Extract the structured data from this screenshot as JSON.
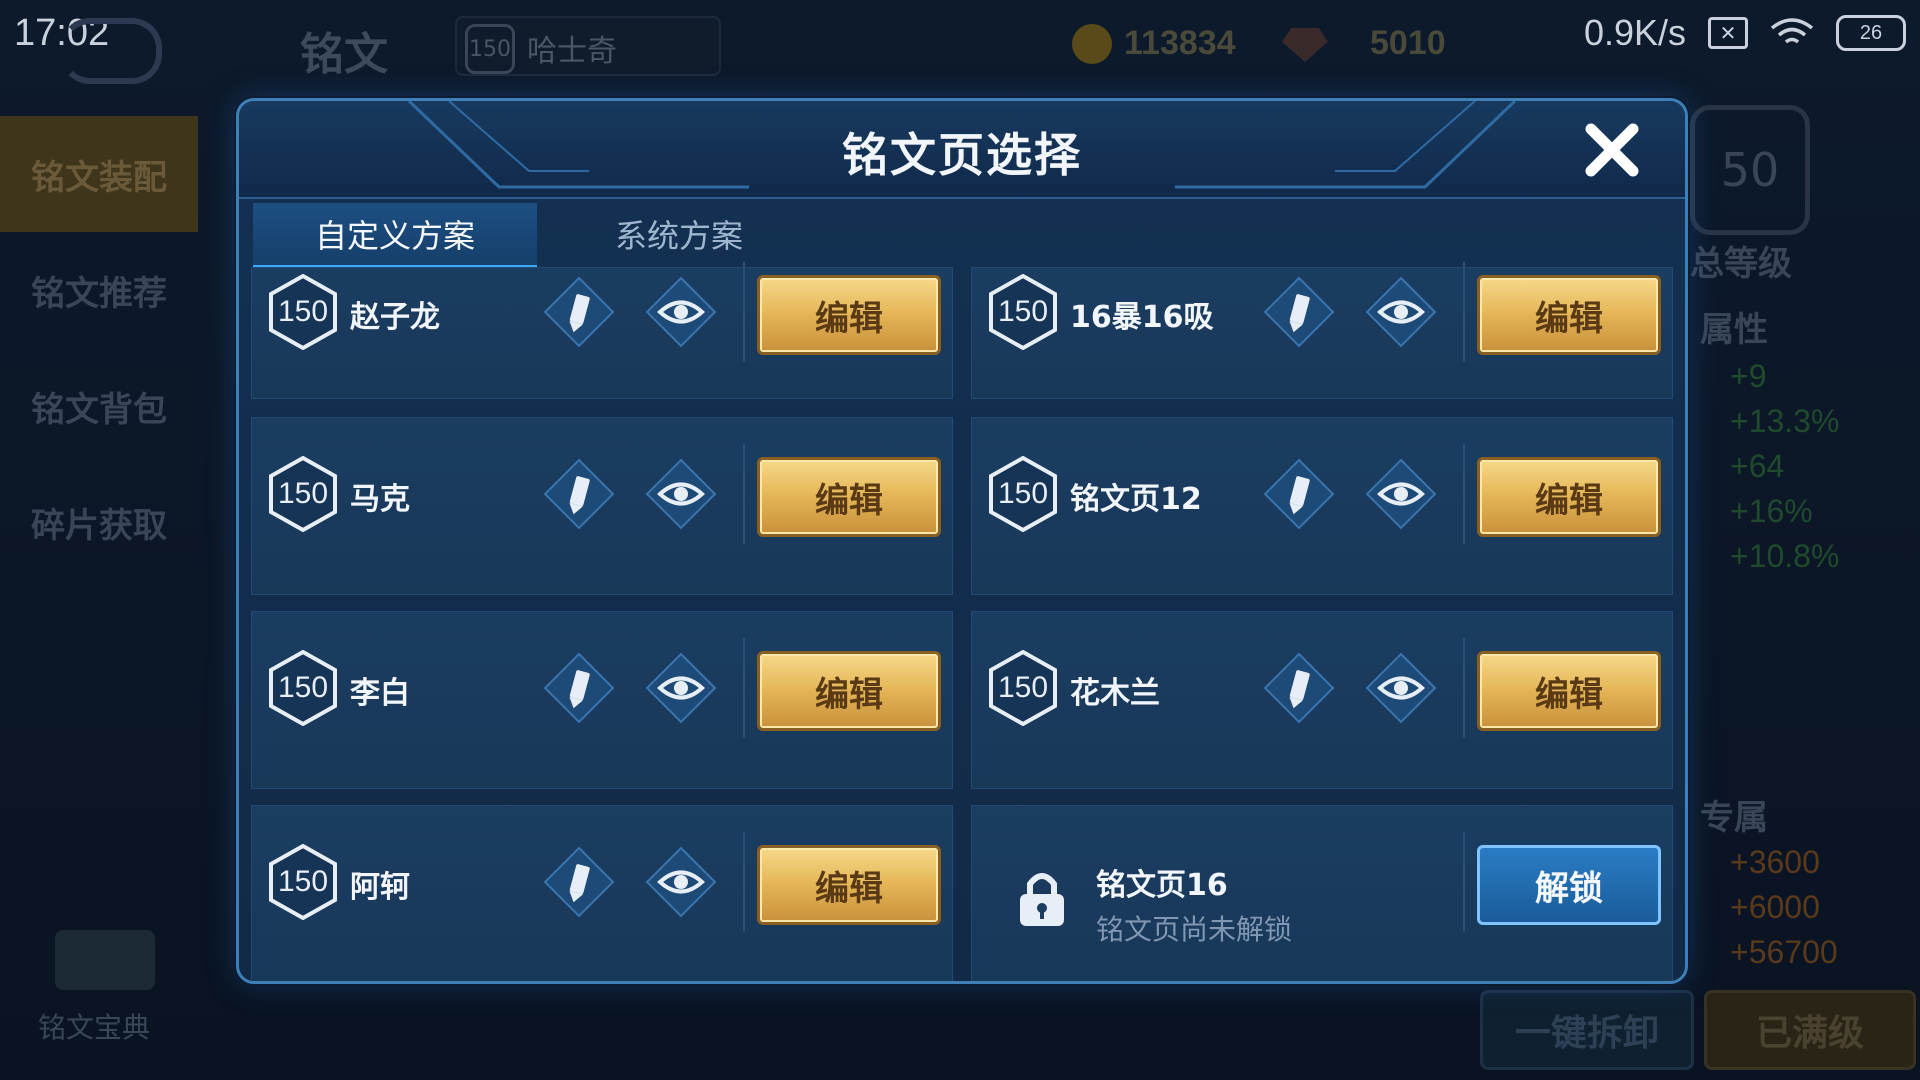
{
  "status_bar": {
    "time": "17:02",
    "net_speed": "0.9K/s",
    "battery": "26"
  },
  "background": {
    "screen_title": "铭文",
    "player_level": "150",
    "player_name": "哈士奇",
    "gold": "113834",
    "gems": "5010",
    "sidebar": [
      "铭文装配",
      "铭文推荐",
      "铭文背包",
      "碎片获取"
    ],
    "codex_label": "铭文宝典",
    "right_hex_level": "50",
    "right_total_level": "总等级",
    "right_attr_header": "属性",
    "attr_values": [
      "+9",
      "+13.3%",
      "+64",
      "+16%",
      "+10.8%"
    ],
    "exclusive_header": "专属",
    "exclusive_values": [
      "+3600",
      "+6000",
      "+56700"
    ],
    "dismantle_button": "一键拆卸",
    "maxed_button": "已满级"
  },
  "modal": {
    "title": "铭文页选择",
    "tabs": [
      "自定义方案",
      "系统方案"
    ],
    "active_tab": 0,
    "edit_label": "编辑",
    "unlock_label": "解锁",
    "pages": [
      {
        "level": "150",
        "name": "赵子龙"
      },
      {
        "level": "150",
        "name": "16暴16吸"
      },
      {
        "level": "150",
        "name": "马克"
      },
      {
        "level": "150",
        "name": "铭文页12"
      },
      {
        "level": "150",
        "name": "李白"
      },
      {
        "level": "150",
        "name": "花木兰"
      },
      {
        "level": "150",
        "name": "阿轲"
      }
    ],
    "locked_page": {
      "name": "铭文页16",
      "status": "铭文页尚未解锁"
    }
  },
  "colors": {
    "modal_bg": "#133153",
    "modal_border": "#3f7fb8",
    "edit_gold": "#e6b85a",
    "unlock_blue": "#1a5c9a",
    "tab_accent": "#3ba7ff"
  }
}
